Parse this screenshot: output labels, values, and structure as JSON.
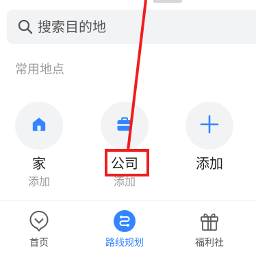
{
  "search": {
    "placeholder": "搜索目的地",
    "icon": "search-icon"
  },
  "section_title": "常用地点",
  "places": [
    {
      "icon": "home-icon",
      "label": "家",
      "sub": "添加"
    },
    {
      "icon": "briefcase-icon",
      "label": "公司",
      "sub": "添加"
    },
    {
      "icon": "plus-icon",
      "label": "添加"
    }
  ],
  "bottom_nav": [
    {
      "icon": "home-nav-icon",
      "label": "首页",
      "active": false
    },
    {
      "icon": "route-plan-icon",
      "label": "路线规划",
      "active": true
    },
    {
      "icon": "gift-icon",
      "label": "福利社",
      "active": false
    }
  ],
  "colors": {
    "accent": "#3385ff",
    "annotation": "#f21c1c"
  }
}
